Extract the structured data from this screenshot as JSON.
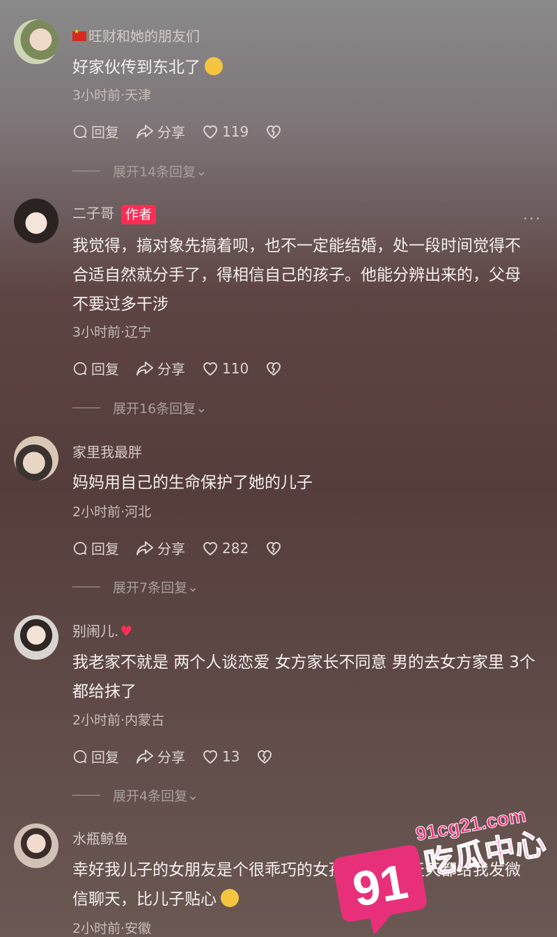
{
  "comments": [
    {
      "username": "旺财和她的朋友们",
      "has_flag": true,
      "text": "好家伙传到东北了",
      "emoji": "grinning-sweat-emoji",
      "meta": "3小时前·天津",
      "reply_label": "回复",
      "share_label": "分享",
      "likes": "119",
      "expand_label": "展开14条回复"
    },
    {
      "username": "二子哥",
      "badge": "作者",
      "text": "我觉得，搞对象先搞着呗，也不一定能结婚，处一段时间觉得不合适自然就分手了，得相信自己的孩子。他能分辨出来的，父母不要过多干涉",
      "meta": "3小时前·辽宁",
      "reply_label": "回复",
      "share_label": "分享",
      "likes": "110",
      "expand_label": "展开16条回复",
      "more_label": "..."
    },
    {
      "username": "家里我最胖",
      "text": "妈妈用自己的生命保护了她的儿子",
      "meta": "2小时前·河北",
      "reply_label": "回复",
      "share_label": "分享",
      "likes": "282",
      "expand_label": "展开7条回复"
    },
    {
      "username": "别闹儿.",
      "username_suffix_icon": "heart-icon",
      "text": "我老家不就是  两个人谈恋爱  女方家长不同意  男的去女方家里  3个都给抹了",
      "meta": "2小时前·内蒙古",
      "reply_label": "回复",
      "share_label": "分享",
      "likes": "13",
      "expand_label": "展开4条回复"
    },
    {
      "username": "水瓶鲸鱼",
      "text": "幸好我儿子的女朋友是个很乖巧的女孩，在大学天天都给我发微信聊天，比儿子贴心",
      "emoji": "grinning-emoji",
      "meta": "2小时前·安徽"
    }
  ],
  "watermark": {
    "number": "91",
    "site": "91cg21.com",
    "name": "吃瓜中心",
    "color": "#e8307a"
  },
  "colors": {
    "author_badge": "#fe2c55",
    "heart": "#ff2d55"
  }
}
